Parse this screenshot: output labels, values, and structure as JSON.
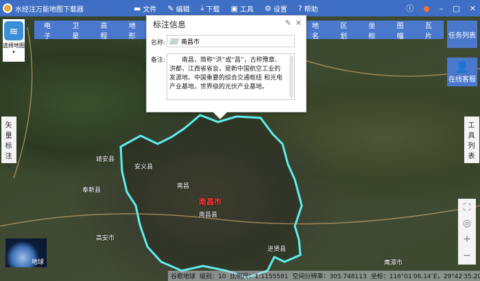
{
  "app": {
    "title": "水经注万能地图下载器"
  },
  "menu": [
    {
      "label": "文件",
      "icon": "folder-icon"
    },
    {
      "label": "编辑",
      "icon": "edit-icon"
    },
    {
      "label": "下载",
      "icon": "download-icon"
    },
    {
      "label": "工具",
      "icon": "toolbox-icon"
    },
    {
      "label": "设置",
      "icon": "gear-icon"
    },
    {
      "label": "帮助",
      "icon": "help-icon"
    }
  ],
  "map_types": [
    "电子",
    "卫星",
    "高程",
    "地形"
  ],
  "overlays": [
    "地名",
    "区划",
    "坐标",
    "图幅",
    "瓦片"
  ],
  "select_map": "选择地图",
  "task_list": "任务列表",
  "online_service": "在线客服",
  "vector_panel": "矢量标注",
  "tools_panel": "工具列表",
  "popup": {
    "title": "标注信息",
    "name_label": "名称:",
    "name_value": "南昌市",
    "note_label": "备注:",
    "note_value": "南昌，简称“洪”或“昌”，古称豫章、洪都，江西省省会，是新中国航空工业的发源地、中国重要的综合交通枢纽 和光电产业基地，世界级的光伏产业基地。"
  },
  "globe_label": "地球",
  "status": {
    "source": "谷歌地球",
    "level": "级别：10",
    "scale": "比例尺：1:1155581",
    "resolution": "空间分辨率：305.748113",
    "coord": "坐标：116°01′06.14″E，29°42′35.20″N"
  },
  "places": {
    "city": "南昌市",
    "nanchang": "南昌",
    "ncx": "南昌县",
    "anyi": "安义县",
    "jingan": "靖安县",
    "fengxin": "奉新县",
    "gaoan": "高安市",
    "jinxian": "进贤县",
    "yingtan": "鹰潭市"
  },
  "colors": {
    "accent": "#4a78cc",
    "boundary": "#5ff0f0"
  }
}
